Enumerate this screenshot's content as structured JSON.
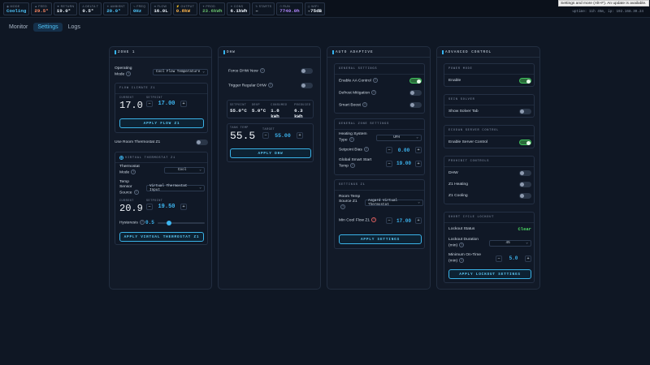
{
  "stats": [
    {
      "label": "MODE",
      "icon": "◉",
      "value": "Cooling",
      "color": "#4fc3f7"
    },
    {
      "label": "FEED",
      "icon": "▲",
      "value": "29.5°",
      "color": "#ff8a65"
    },
    {
      "label": "RETURN",
      "icon": "▼",
      "value": "19.0°",
      "color": "#e6edf5"
    },
    {
      "label": "DELTA T",
      "icon": "Δ",
      "value": "0.5°",
      "color": "#e6edf5"
    },
    {
      "label": "AMBIENT",
      "icon": "☀",
      "value": "20.0°",
      "color": "#4fc3f7"
    },
    {
      "label": "FREQ",
      "icon": "∿",
      "value": "0Hz",
      "color": "#4fc3f7"
    },
    {
      "label": "FLOW",
      "icon": "≋",
      "value": "16.0L",
      "color": "#e6edf5"
    },
    {
      "label": "OUTPUT",
      "icon": "⚡",
      "value": "0.8kW",
      "color": "#ffb74d"
    },
    {
      "label": "PROD",
      "icon": "✦",
      "value": "23.6kWh",
      "color": "#66bb6a"
    },
    {
      "label": "CONS",
      "icon": "✦",
      "value": "6.1kWh",
      "color": "#e6edf5"
    },
    {
      "label": "STARTS",
      "icon": "↻",
      "value": "–",
      "color": "#e6edf5"
    },
    {
      "label": "RUN",
      "icon": "⏱",
      "value": "7740.0h",
      "color": "#b388ff"
    },
    {
      "label": "WIFI",
      "icon": "◎",
      "value": "-75dB",
      "color": "#e6edf5"
    }
  ],
  "tooltip": "Settings and more (Alt+F). An update is available.",
  "uptime": "uptime: 11h 45m, ip: 192.168.30.24",
  "tabs": [
    "Monitor",
    "Settings",
    "Logs"
  ],
  "zone1": {
    "title": "ZONE 1",
    "op_mode_label": "Operating Mode",
    "op_mode_value": "Cool Flow Temperature",
    "flow_climate_title": "FLOW CLIMATE Z1",
    "current_label": "CURRENT",
    "current_value": "17.0",
    "setpoint_label": "SETPOINT",
    "setpoint_value": "17.00",
    "apply_flow": "APPLY FLOW Z1",
    "use_room_label": "Use Room Thermostat Z1",
    "vt_title": "VIRTUAL THERMOSTAT Z1",
    "thermostat_mode_label": "Thermostat Mode",
    "thermostat_mode_value": "Cool",
    "temp_sensor_label": "Temp Sensor Source",
    "temp_sensor_value": "Virtual Thermostat Input",
    "vt_current_label": "CURRENT",
    "vt_current_value": "20.9",
    "vt_setpoint_label": "SETPOINT",
    "vt_setpoint_value": "19.50",
    "hysteresis_label": "Hysteresis",
    "hysteresis_value": "0.5",
    "hysteresis_fraction": 0.25,
    "apply_vt": "APPLY VIRTUAL THERMOSTAT Z1"
  },
  "dhw": {
    "title": "DHW",
    "force_label": "Force DHW Now",
    "trigger_label": "Trigger Regular DHW",
    "metrics": [
      {
        "label": "SETPOINT",
        "value": "55.0°C"
      },
      {
        "label": "DROP",
        "value": "5.0°C"
      },
      {
        "label": "CONSUMED",
        "value": "1.8 kWh"
      },
      {
        "label": "PRODUCED",
        "value": "6.3 kWh"
      }
    ],
    "tank_label": "TANK TEMP",
    "tank_value": "55.5",
    "target_label": "TARGET",
    "target_value": "55.00",
    "apply": "APPLY DHW"
  },
  "auto": {
    "title": "AUTO ADAPTIVE",
    "general_title": "GENERAL SETTINGS",
    "enable_ai": "Enable AA Control",
    "defrost": "Defrost Mitigation",
    "smart_boost": "Smart Boost",
    "gz_title": "GENERAL ZONE SETTINGS",
    "heating_type_label": "Heating System Type",
    "heating_type_value": "UFH",
    "setpoint_bias_label": "Setpoint Bias",
    "setpoint_bias_value": "0.00",
    "global_smart_label": "Global Smart Start Temp",
    "global_smart_value": "19.00",
    "z1_title": "SETTINGS Z1",
    "room_temp_label": "Room Temp Source Z1",
    "room_temp_value": "Asgard Virtual Thermostat",
    "min_cool_label": "Min Cool Flow Z1",
    "min_cool_value": "17.00",
    "apply": "APPLY SETTINGS"
  },
  "advanced": {
    "title": "ADVANCED CONTROL",
    "power_title": "POWER MODE",
    "enable_label": "Enable",
    "solver_title": "SEIN SOLVER",
    "show_solver": "Show Solver Tab",
    "server_title": "ECODAN SERVER CONTROL",
    "enable_server": "Enable Server Control",
    "prohibit_title": "PROHIBIT CONTROLS",
    "dhw": "DHW",
    "z1_heating": "Z1 Heating",
    "z1_cooling": "Z1 Cooling",
    "scl_title": "SHORT CYCLE LOCKOUT",
    "lockout_status_label": "Lockout Status",
    "lockout_status_value": "Clear",
    "lockout_duration_label": "Lockout Duration (min)",
    "lockout_duration_value": "45",
    "min_ontime_label": "Minimum On-Time (min)",
    "min_ontime_value": "5.0",
    "apply": "APPLY LOCKOUT SETTINGS"
  },
  "colors": {
    "accent": "#3db5f0",
    "on": "#3fbf5c",
    "clear": "#4cd964"
  }
}
